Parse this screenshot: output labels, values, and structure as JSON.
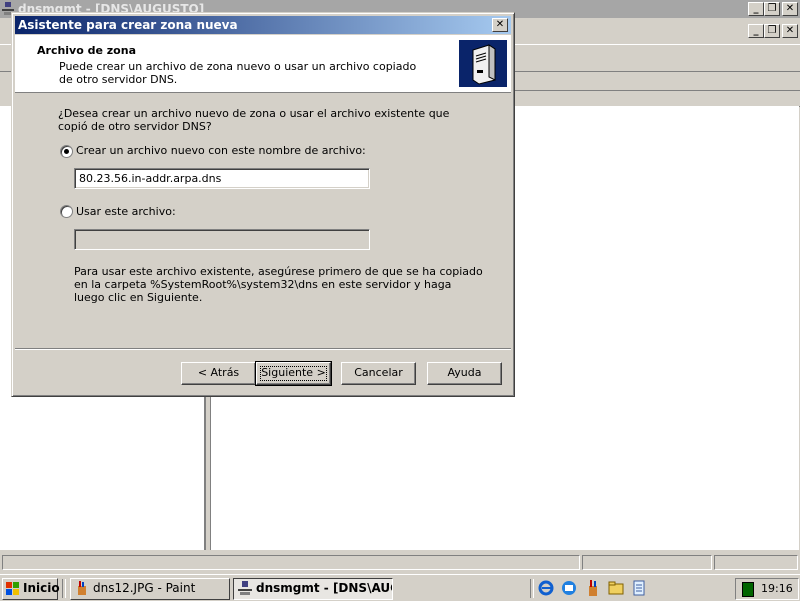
{
  "background_window": {
    "title": "dnsmgmt - [DNS\\AUGUSTO]",
    "controls": [
      "minimize",
      "restore",
      "close"
    ]
  },
  "dialog": {
    "title": "Asistente para crear zona nueva",
    "header": {
      "title": "Archivo de zona",
      "subtitle": "Puede crear un archivo de zona nuevo o usar un archivo copiado de otro servidor DNS.",
      "icon": "server-icon"
    },
    "question": "¿Desea crear un archivo nuevo de zona o usar el archivo existente que copió de otro servidor DNS?",
    "option_new": {
      "label": "Crear un archivo nuevo con este nombre de archivo:",
      "selected": true,
      "value": "80.23.56.in-addr.arpa.dns"
    },
    "option_existing": {
      "label": "Usar este archivo:",
      "selected": false,
      "value": ""
    },
    "note": "Para usar este archivo existente, asegúrese primero de que se ha copiado en la carpeta %SystemRoot%\\system32\\dns en este servidor y haga luego clic en Siguiente.",
    "buttons": {
      "back": "< Atrás",
      "next": "Siguiente >",
      "cancel": "Cancelar",
      "help": "Ayuda"
    }
  },
  "taskbar": {
    "start_label": "Inicio",
    "tasks": [
      {
        "label": "dns12.JPG - Paint",
        "icon": "paint-icon",
        "active": false
      },
      {
        "label": "dnsmgmt - [DNS\\AUG...",
        "icon": "dns-console-icon",
        "active": true
      }
    ],
    "quick_launch": [
      "ie-icon",
      "outlook-express-icon",
      "paint-icon",
      "folder-icon",
      "notepad-icon"
    ],
    "clock": "19:16"
  },
  "colors": {
    "title_active_start": "#0a246a",
    "title_active_end": "#a6caf0",
    "title_inactive": "#a6a6a6",
    "face": "#d4d0c8"
  }
}
